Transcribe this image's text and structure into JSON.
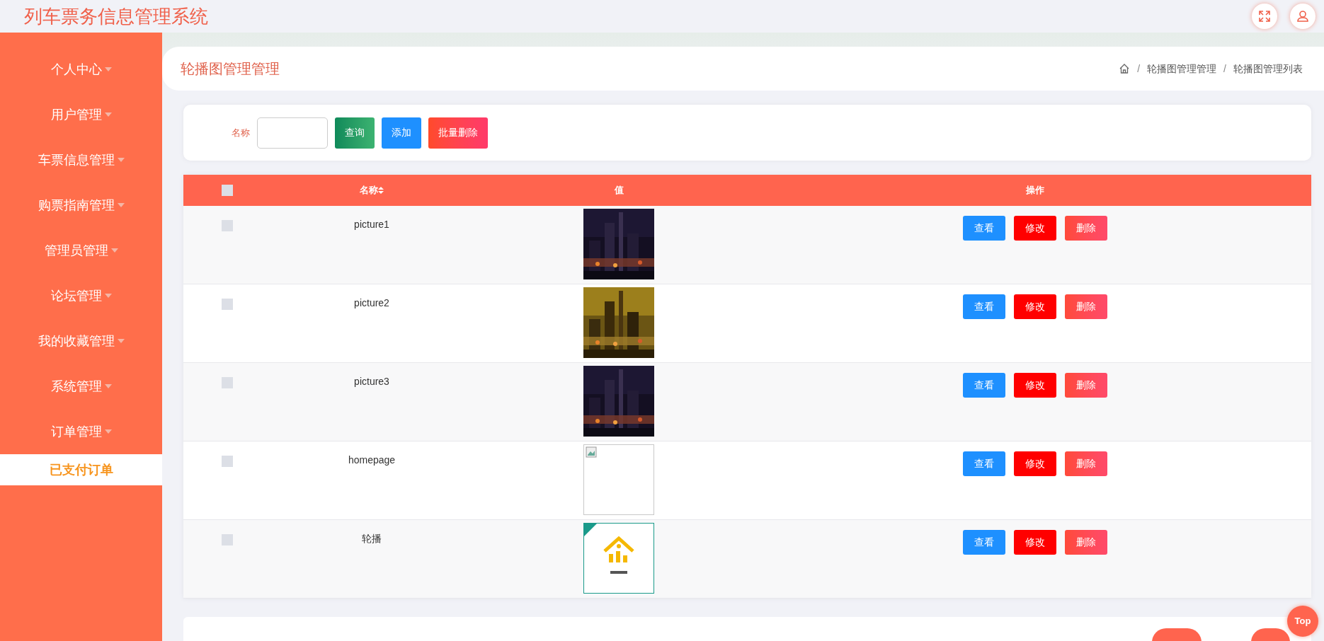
{
  "app_title": "列车票务信息管理系统",
  "menu": [
    {
      "label": "个人中心",
      "selected": false
    },
    {
      "label": "用户管理",
      "selected": false
    },
    {
      "label": "车票信息管理",
      "selected": false
    },
    {
      "label": "购票指南管理",
      "selected": false
    },
    {
      "label": "管理员管理",
      "selected": false
    },
    {
      "label": "论坛管理",
      "selected": false
    },
    {
      "label": "我的收藏管理",
      "selected": false
    },
    {
      "label": "系统管理",
      "selected": false
    },
    {
      "label": "订单管理",
      "selected": false,
      "expanded": true,
      "children": [
        {
          "label": "已支付订单",
          "selected": true
        }
      ]
    }
  ],
  "page_title": "轮播图管理管理",
  "breadcrumb": [
    {
      "separator": "/",
      "label": "轮播图管理管理"
    },
    {
      "separator": "/",
      "label": "轮播图管理列表"
    }
  ],
  "search": {
    "label": "名称",
    "buttons": [
      {
        "label": "查询",
        "kind": "query"
      },
      {
        "label": "添加",
        "kind": "add"
      },
      {
        "label": "批量删除",
        "kind": "batch-delete"
      }
    ]
  },
  "table": {
    "header_checked": false,
    "columns": [
      "名称",
      "值",
      "操作"
    ],
    "rows": [
      {
        "checked": false,
        "name": "picture1",
        "actions": [
          {
            "label": "查看",
            "kind": "view"
          },
          {
            "label": "修改",
            "kind": "edit"
          },
          {
            "label": "删除",
            "kind": "delete"
          }
        ]
      },
      {
        "checked": false,
        "name": "picture2",
        "actions": [
          {
            "label": "查看",
            "kind": "view"
          },
          {
            "label": "修改",
            "kind": "edit"
          },
          {
            "label": "删除",
            "kind": "delete"
          }
        ]
      },
      {
        "checked": false,
        "name": "picture3",
        "actions": [
          {
            "label": "查看",
            "kind": "view"
          },
          {
            "label": "修改",
            "kind": "edit"
          },
          {
            "label": "删除",
            "kind": "delete"
          }
        ]
      },
      {
        "checked": false,
        "name": "homepage",
        "value": {
          "kind": "broken"
        },
        "actions": [
          {
            "label": "查看",
            "kind": "view"
          },
          {
            "label": "修改",
            "kind": "edit"
          },
          {
            "label": "删除",
            "kind": "delete"
          }
        ]
      },
      {
        "checked": false,
        "name": "轮播",
        "value": {
          "kind": "logo"
        },
        "actions": [
          {
            "label": "查看",
            "kind": "view"
          },
          {
            "label": "修改",
            "kind": "edit"
          },
          {
            "label": "删除",
            "kind": "delete"
          }
        ]
      }
    ]
  },
  "top_button": "Top"
}
